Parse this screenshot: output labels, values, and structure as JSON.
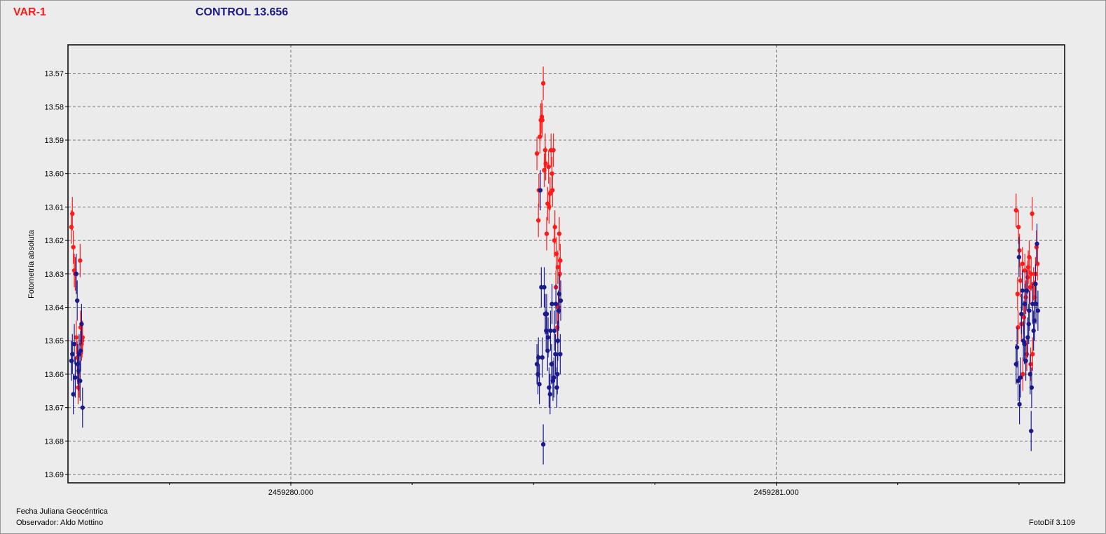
{
  "header": {
    "var_label": "VAR-1",
    "control_label": "CONTROL 13.656"
  },
  "footer": {
    "xlabel": "Fecha Juliana Geocéntrica",
    "observer": "Observador: Aldo Mottino",
    "software": "FotoDif 3.109"
  },
  "colors": {
    "var": "#ff1a1a",
    "control": "#1a1a8c"
  },
  "chart_data": {
    "type": "scatter",
    "ylabel": "Fotometría absoluta",
    "xlabel": "Fecha Juliana Geocéntrica",
    "y_inverted": true,
    "xlim": [
      2459279.541,
      2459281.594
    ],
    "ylim": [
      13.5615,
      13.6925
    ],
    "x_ticks": [
      2459280.0,
      2459281.0
    ],
    "x_tick_labels": [
      "2459280.000",
      "2459281.000"
    ],
    "y_ticks": [
      13.57,
      13.58,
      13.59,
      13.6,
      13.61,
      13.62,
      13.63,
      13.64,
      13.65,
      13.66,
      13.67,
      13.68,
      13.69
    ],
    "y_tick_labels": [
      "13.57",
      "13.58",
      "13.59",
      "13.60",
      "13.61",
      "13.62",
      "13.63",
      "13.64",
      "13.65",
      "13.66",
      "13.67",
      "13.68",
      "13.69"
    ],
    "grid": true,
    "series": [
      {
        "name": "VAR-1",
        "color": "#ff1a1a",
        "error": 0.005,
        "points": [
          [
            2459279.548,
            13.616
          ],
          [
            2459279.55,
            13.612
          ],
          [
            2459279.552,
            13.622
          ],
          [
            2459279.554,
            13.629
          ],
          [
            2459279.556,
            13.63
          ],
          [
            2459279.558,
            13.649
          ],
          [
            2459279.56,
            13.655
          ],
          [
            2459279.562,
            13.664
          ],
          [
            2459279.564,
            13.662
          ],
          [
            2459279.566,
            13.626
          ],
          [
            2459279.567,
            13.646
          ],
          [
            2459279.569,
            13.651
          ],
          [
            2459279.57,
            13.65
          ],
          [
            2459279.571,
            13.649
          ],
          [
            2459280.507,
            13.594
          ],
          [
            2459280.51,
            13.614
          ],
          [
            2459280.511,
            13.605
          ],
          [
            2459280.513,
            13.589
          ],
          [
            2459280.515,
            13.584
          ],
          [
            2459280.517,
            13.583
          ],
          [
            2459280.518,
            13.584
          ],
          [
            2459280.52,
            13.573
          ],
          [
            2459280.522,
            13.599
          ],
          [
            2459280.524,
            13.593
          ],
          [
            2459280.525,
            13.597
          ],
          [
            2459280.527,
            13.618
          ],
          [
            2459280.529,
            13.609
          ],
          [
            2459280.531,
            13.598
          ],
          [
            2459280.532,
            13.61
          ],
          [
            2459280.534,
            13.606
          ],
          [
            2459280.536,
            13.593
          ],
          [
            2459280.538,
            13.6
          ],
          [
            2459280.539,
            13.605
          ],
          [
            2459280.541,
            13.593
          ],
          [
            2459280.543,
            13.62
          ],
          [
            2459280.544,
            13.616
          ],
          [
            2459280.546,
            13.634
          ],
          [
            2459280.547,
            13.624
          ],
          [
            2459280.549,
            13.646
          ],
          [
            2459280.55,
            13.628
          ],
          [
            2459280.551,
            13.64
          ],
          [
            2459280.553,
            13.618
          ],
          [
            2459280.554,
            13.63
          ],
          [
            2459280.555,
            13.626
          ],
          [
            2459281.494,
            13.611
          ],
          [
            2459281.497,
            13.636
          ],
          [
            2459281.498,
            13.646
          ],
          [
            2459281.499,
            13.616
          ],
          [
            2459281.501,
            13.623
          ],
          [
            2459281.503,
            13.632
          ],
          [
            2459281.505,
            13.645
          ],
          [
            2459281.507,
            13.627
          ],
          [
            2459281.508,
            13.66
          ],
          [
            2459281.51,
            13.643
          ],
          [
            2459281.512,
            13.629
          ],
          [
            2459281.514,
            13.637
          ],
          [
            2459281.516,
            13.654
          ],
          [
            2459281.518,
            13.631
          ],
          [
            2459281.519,
            13.628
          ],
          [
            2459281.521,
            13.625
          ],
          [
            2459281.523,
            13.634
          ],
          [
            2459281.524,
            13.657
          ],
          [
            2459281.525,
            13.63
          ],
          [
            2459281.527,
            13.612
          ],
          [
            2459281.528,
            13.654
          ],
          [
            2459281.53,
            13.633
          ],
          [
            2459281.532,
            13.637
          ],
          [
            2459281.534,
            13.63
          ],
          [
            2459281.536,
            13.622
          ],
          [
            2459281.538,
            13.627
          ]
        ]
      },
      {
        "name": "CONTROL 13.656",
        "color": "#1a1a8c",
        "error": 0.006,
        "points": [
          [
            2459279.548,
            13.656
          ],
          [
            2459279.55,
            13.654
          ],
          [
            2459279.552,
            13.666
          ],
          [
            2459279.554,
            13.651
          ],
          [
            2459279.556,
            13.661
          ],
          [
            2459279.558,
            13.63
          ],
          [
            2459279.56,
            13.638
          ],
          [
            2459279.561,
            13.657
          ],
          [
            2459279.563,
            13.659
          ],
          [
            2459279.564,
            13.654
          ],
          [
            2459279.566,
            13.662
          ],
          [
            2459279.567,
            13.653
          ],
          [
            2459279.569,
            13.645
          ],
          [
            2459279.571,
            13.67
          ],
          [
            2459280.507,
            13.657
          ],
          [
            2459280.509,
            13.66
          ],
          [
            2459280.51,
            13.655
          ],
          [
            2459280.512,
            13.663
          ],
          [
            2459280.514,
            13.605
          ],
          [
            2459280.516,
            13.634
          ],
          [
            2459280.518,
            13.655
          ],
          [
            2459280.52,
            13.681
          ],
          [
            2459280.522,
            13.634
          ],
          [
            2459280.524,
            13.642
          ],
          [
            2459280.526,
            13.647
          ],
          [
            2459280.527,
            13.642
          ],
          [
            2459280.529,
            13.653
          ],
          [
            2459280.53,
            13.649
          ],
          [
            2459280.532,
            13.664
          ],
          [
            2459280.534,
            13.666
          ],
          [
            2459280.535,
            13.647
          ],
          [
            2459280.537,
            13.657
          ],
          [
            2459280.538,
            13.639
          ],
          [
            2459280.54,
            13.662
          ],
          [
            2459280.542,
            13.661
          ],
          [
            2459280.543,
            13.647
          ],
          [
            2459280.545,
            13.654
          ],
          [
            2459280.546,
            13.639
          ],
          [
            2459280.548,
            13.664
          ],
          [
            2459280.549,
            13.66
          ],
          [
            2459280.55,
            13.65
          ],
          [
            2459280.552,
            13.641
          ],
          [
            2459280.553,
            13.636
          ],
          [
            2459280.555,
            13.654
          ],
          [
            2459280.556,
            13.638
          ],
          [
            2459281.494,
            13.657
          ],
          [
            2459281.496,
            13.652
          ],
          [
            2459281.498,
            13.662
          ],
          [
            2459281.5,
            13.625
          ],
          [
            2459281.501,
            13.669
          ],
          [
            2459281.503,
            13.661
          ],
          [
            2459281.505,
            13.642
          ],
          [
            2459281.507,
            13.635
          ],
          [
            2459281.509,
            13.65
          ],
          [
            2459281.511,
            13.651
          ],
          [
            2459281.512,
            13.639
          ],
          [
            2459281.514,
            13.656
          ],
          [
            2459281.516,
            13.635
          ],
          [
            2459281.518,
            13.649
          ],
          [
            2459281.52,
            13.645
          ],
          [
            2459281.521,
            13.641
          ],
          [
            2459281.523,
            13.66
          ],
          [
            2459281.525,
            13.677
          ],
          [
            2459281.526,
            13.664
          ],
          [
            2459281.528,
            13.639
          ],
          [
            2459281.53,
            13.647
          ],
          [
            2459281.532,
            13.644
          ],
          [
            2459281.534,
            13.633
          ],
          [
            2459281.535,
            13.639
          ],
          [
            2459281.537,
            13.621
          ],
          [
            2459281.539,
            13.641
          ]
        ]
      }
    ]
  }
}
